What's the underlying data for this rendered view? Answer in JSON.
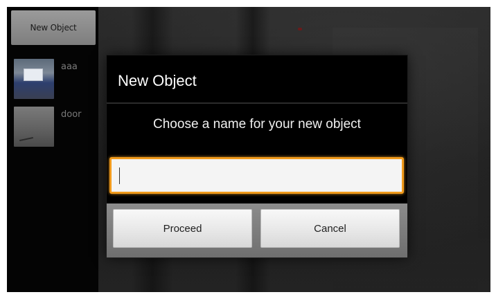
{
  "sidebar": {
    "new_object_label": "New Object",
    "items": [
      {
        "label": "aaa"
      },
      {
        "label": "door"
      }
    ]
  },
  "dialog": {
    "title": "New Object",
    "message": "Choose a name for your new object",
    "input_value": "",
    "proceed_label": "Proceed",
    "cancel_label": "Cancel",
    "accent_color": "#f09a1c"
  }
}
